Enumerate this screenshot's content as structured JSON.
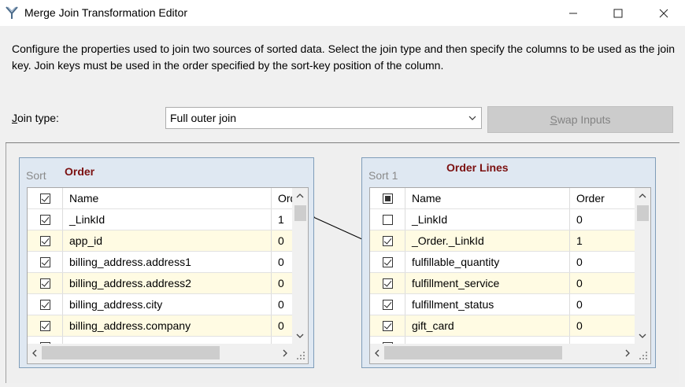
{
  "window": {
    "title": "Merge Join Transformation Editor"
  },
  "description": "Configure the properties used to join two sources of sorted data. Select the join type and then specify the columns to be used as the join key. Join keys must be used in the order specified by the sort-key position of the column.",
  "join_type": {
    "label_prefix": "",
    "label_accel": "J",
    "label_rest": "oin type:",
    "selected": "Full outer join"
  },
  "swap_button": {
    "accel": "S",
    "rest": "wap Inputs"
  },
  "left_panel": {
    "sort_label": "Sort",
    "title": "Order",
    "columns": {
      "name": "Name",
      "order": "Order"
    },
    "rows": [
      {
        "name": "_LinkId",
        "order": "1",
        "checked": true
      },
      {
        "name": "app_id",
        "order": "0",
        "checked": true
      },
      {
        "name": "billing_address.address1",
        "order": "0",
        "checked": true
      },
      {
        "name": "billing_address.address2",
        "order": "0",
        "checked": true
      },
      {
        "name": "billing_address.city",
        "order": "0",
        "checked": true
      },
      {
        "name": "billing_address.company",
        "order": "0",
        "checked": true
      }
    ]
  },
  "right_panel": {
    "sort_label": "Sort 1",
    "title": "Order Lines",
    "columns": {
      "name": "Name",
      "order": "Order"
    },
    "rows": [
      {
        "name": "_LinkId",
        "order": "0",
        "checked": false
      },
      {
        "name": "_Order._LinkId",
        "order": "1",
        "checked": true
      },
      {
        "name": "fulfillable_quantity",
        "order": "0",
        "checked": true
      },
      {
        "name": "fulfillment_service",
        "order": "0",
        "checked": true
      },
      {
        "name": "fulfillment_status",
        "order": "0",
        "checked": true
      },
      {
        "name": "gift_card",
        "order": "0",
        "checked": true
      }
    ]
  },
  "colors": {
    "panel_title": "#7b1010",
    "alt_row": "#fffbe3",
    "panel_bg": "#dfe8f2"
  }
}
